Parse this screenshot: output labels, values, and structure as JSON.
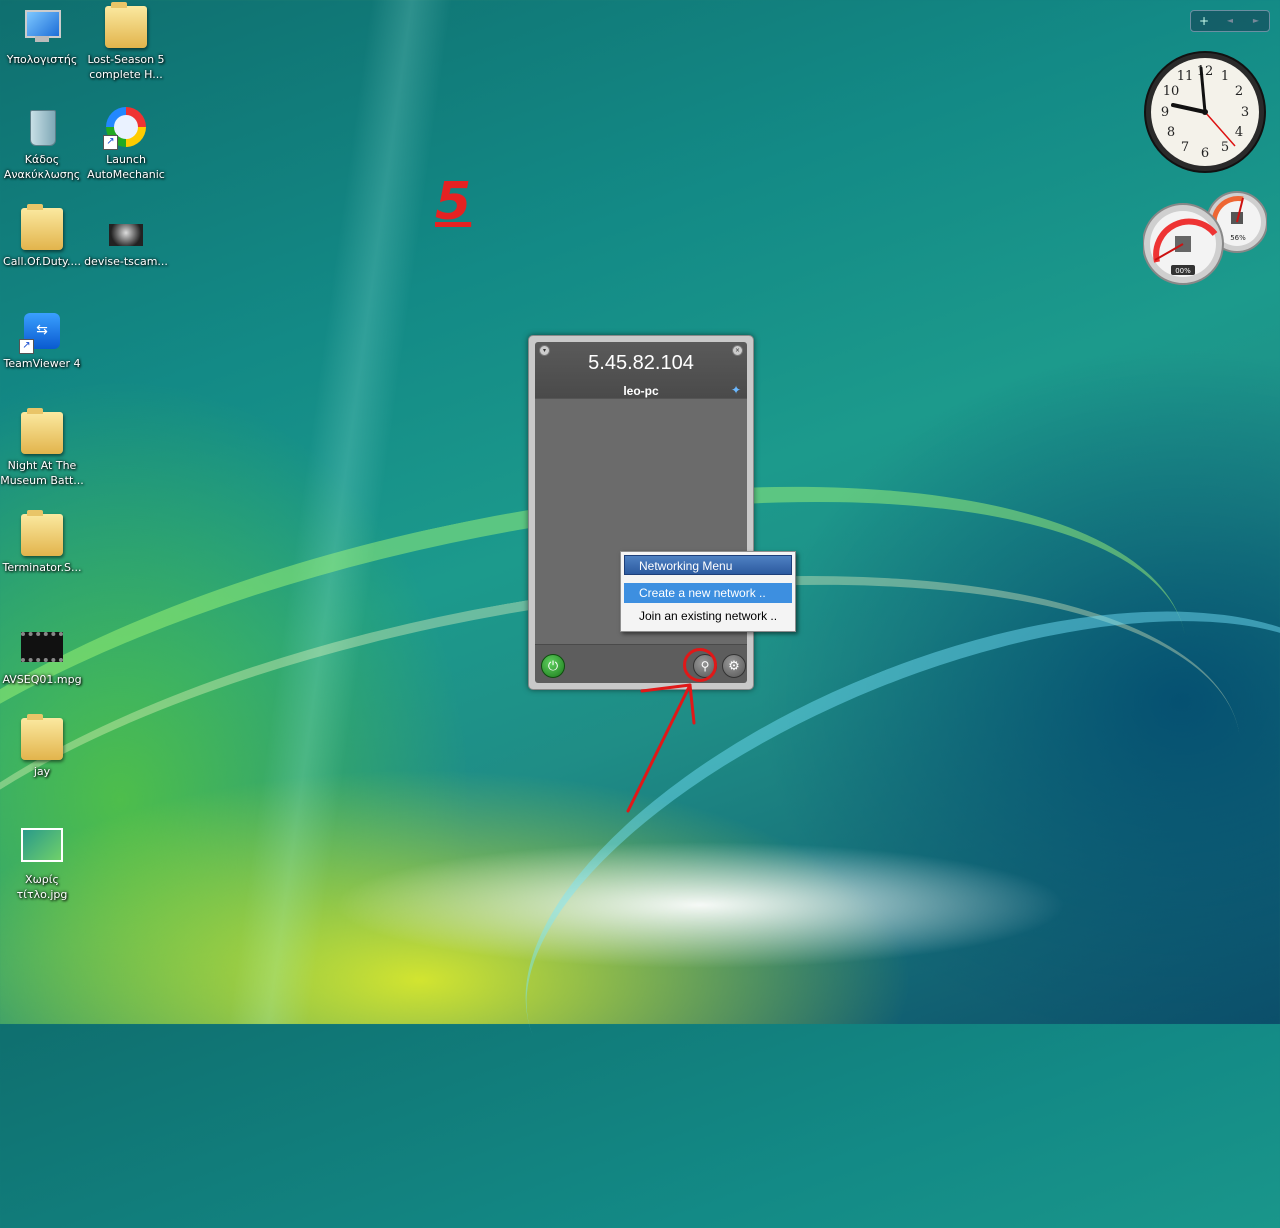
{
  "desktop": {
    "icons": [
      {
        "label": "Υπολογιστής"
      },
      {
        "label": "Lost-Season 5 complete H..."
      },
      {
        "label": "Κάδος Ανακύκλωσης"
      },
      {
        "label": "Launch AutoMechanic"
      },
      {
        "label": "Call.Of.Duty...."
      },
      {
        "label": "devise-tscam..."
      },
      {
        "label": "TeamViewer 4"
      },
      {
        "label": "Night At The Museum Batt..."
      },
      {
        "label": "Terminator.S..."
      },
      {
        "label": "AVSEQ01.mpg"
      },
      {
        "label": "jay"
      },
      {
        "label": "Χωρίς τίτλο.jpg"
      }
    ],
    "annotation_number": "5"
  },
  "sidebar": {
    "add": "+",
    "prev": "◄",
    "next": "►"
  },
  "gadgets": {
    "clock_numbers": [
      "12",
      "1",
      "2",
      "3",
      "4",
      "5",
      "6",
      "7",
      "8",
      "9",
      "10",
      "11"
    ],
    "cpu_percent": "00%",
    "ram_percent": "56%"
  },
  "hamachi": {
    "ip": "5.45.82.104",
    "name": "leo-pc"
  },
  "context_menu": {
    "title": "Networking Menu",
    "create": "Create a new network ..",
    "join": "Join an existing network .."
  }
}
